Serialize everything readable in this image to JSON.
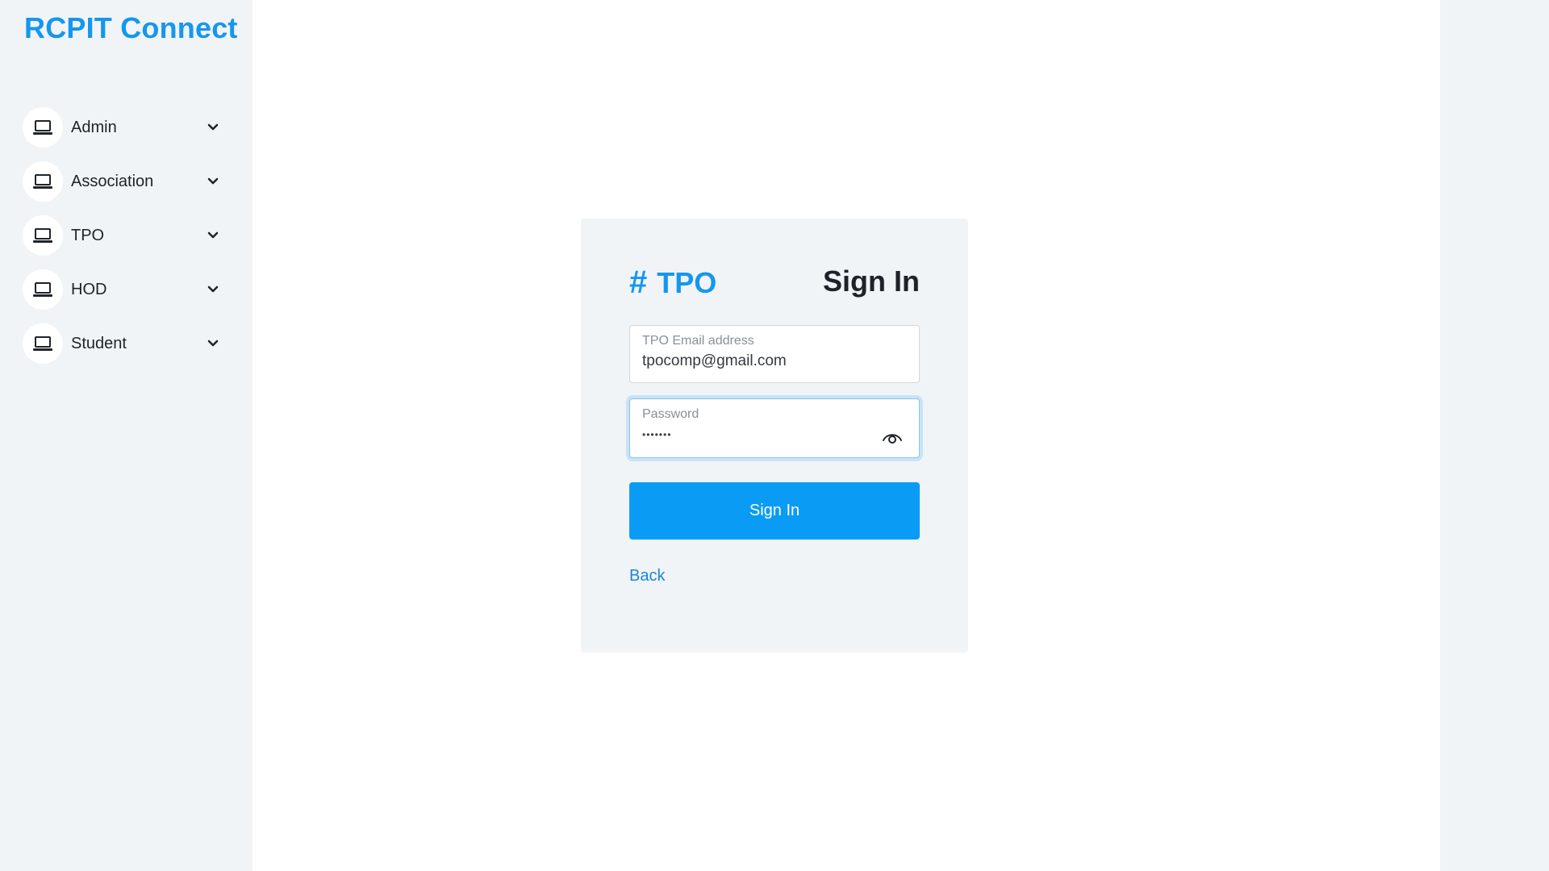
{
  "app": {
    "brand": "RCPIT Connect",
    "accent_color": "#1597ee",
    "primary_button_color": "#0a9cf5",
    "panel_background": "#f1f4f7"
  },
  "sidebar": {
    "items": [
      {
        "label": "Admin",
        "icon": "laptop-icon",
        "chevron": "chevron-down-icon"
      },
      {
        "label": "Association",
        "icon": "laptop-icon",
        "chevron": "chevron-down-icon"
      },
      {
        "label": "TPO",
        "icon": "laptop-icon",
        "chevron": "chevron-down-icon"
      },
      {
        "label": "HOD",
        "icon": "laptop-icon",
        "chevron": "chevron-down-icon"
      },
      {
        "label": "Student",
        "icon": "laptop-icon",
        "chevron": "chevron-down-icon"
      }
    ]
  },
  "login": {
    "role_icon": "#",
    "role_title": "TPO",
    "heading": "Sign In",
    "email": {
      "label": "TPO Email address",
      "value": "tpocomp@gmail.com"
    },
    "password": {
      "label": "Password",
      "value": "•••••••",
      "toggle_icon": "eye-icon"
    },
    "submit_label": "Sign In",
    "back_label": "Back"
  }
}
